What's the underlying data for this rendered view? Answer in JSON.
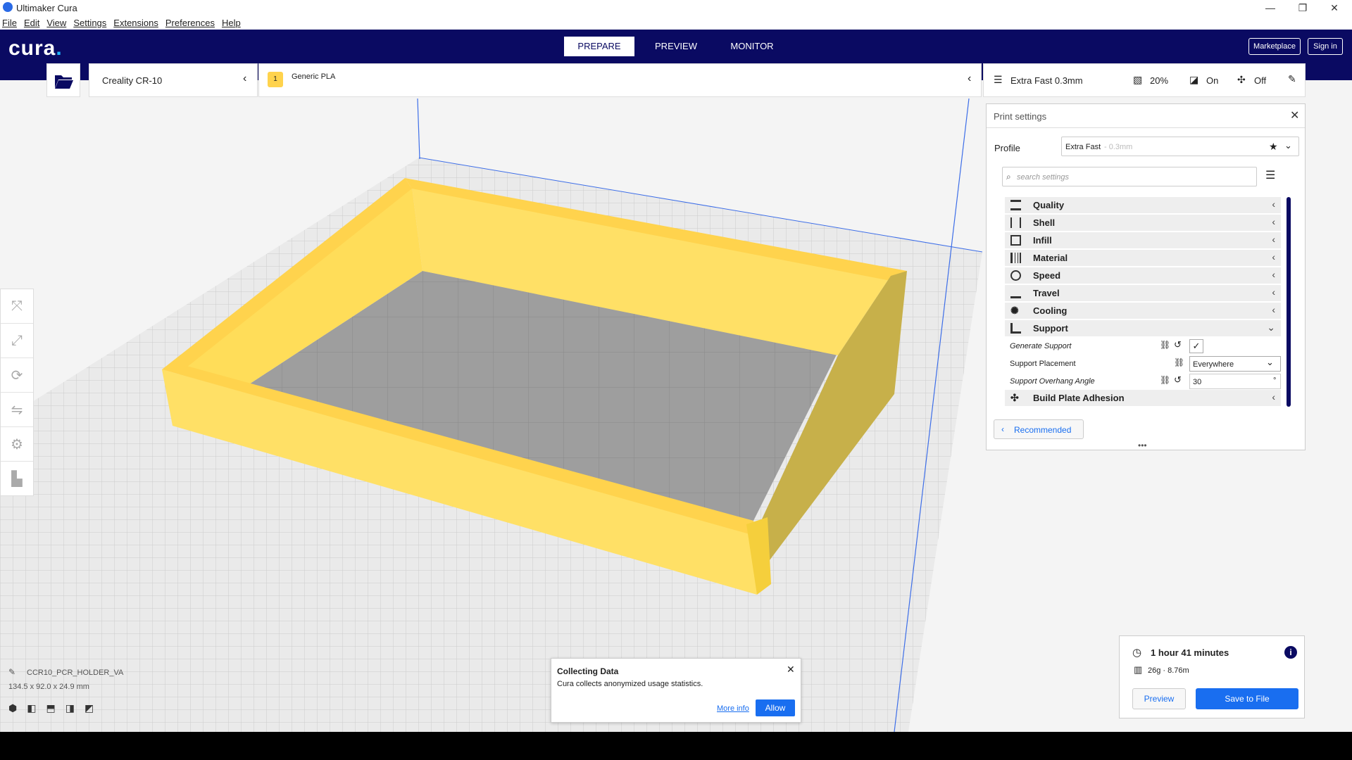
{
  "window": {
    "title": "Ultimaker Cura",
    "minimize_glyph": "—",
    "restore_glyph": "❐",
    "close_glyph": "✕"
  },
  "menu": [
    "File",
    "Edit",
    "View",
    "Settings",
    "Extensions",
    "Preferences",
    "Help"
  ],
  "header": {
    "logo": "cura",
    "logo_dot": ".",
    "tabs": [
      "PREPARE",
      "PREVIEW",
      "MONITOR"
    ],
    "active_tab": "PREPARE",
    "marketplace": "Marketplace",
    "sign_in": "Sign in"
  },
  "printer": {
    "name": "Creality CR-10",
    "material_badge": "1",
    "material": "Generic PLA"
  },
  "settings_bar": {
    "profile": "Extra Fast 0.3mm",
    "infill": "20%",
    "support": "On",
    "adhesion": "Off"
  },
  "print_settings": {
    "title": "Print settings",
    "profile_label": "Profile",
    "profile_name": "Extra Fast",
    "profile_detail": "- 0.3mm",
    "search_placeholder": "search settings",
    "categories": [
      {
        "label": "Quality",
        "icon": "quality-icon"
      },
      {
        "label": "Shell",
        "icon": "shell-icon"
      },
      {
        "label": "Infill",
        "icon": "infill-icon"
      },
      {
        "label": "Material",
        "icon": "material-icon"
      },
      {
        "label": "Speed",
        "icon": "speed-icon"
      },
      {
        "label": "Travel",
        "icon": "travel-icon"
      },
      {
        "label": "Cooling",
        "icon": "cooling-icon"
      },
      {
        "label": "Support",
        "icon": "support-icon"
      }
    ],
    "support_settings": {
      "generate_support": "Generate Support",
      "support_placement": "Support Placement",
      "support_placement_value": "Everywhere",
      "overhang_angle": "Support Overhang Angle",
      "overhang_angle_value": "30",
      "overhang_unit": "°"
    },
    "last_category": "Build Plate Adhesion",
    "recommended_button": "Recommended"
  },
  "object": {
    "name": "CCR10_PCR_HOLDER_VA",
    "dimensions": "134.5 x 92.0 x 24.9 mm"
  },
  "collecting_data": {
    "title": "Collecting Data",
    "message": "Cura collects anonymized usage statistics.",
    "more_info": "More info",
    "allow": "Allow"
  },
  "print_info": {
    "time": "1 hour 41 minutes",
    "material_usage": "26g · 8.76m",
    "preview_button": "Preview",
    "save_button": "Save to File"
  },
  "colors": {
    "header_bg": "#0a0a62",
    "accent_blue": "#196ef0",
    "model_yellow": "#ffe066",
    "build_plate": "#e8e8e8"
  }
}
